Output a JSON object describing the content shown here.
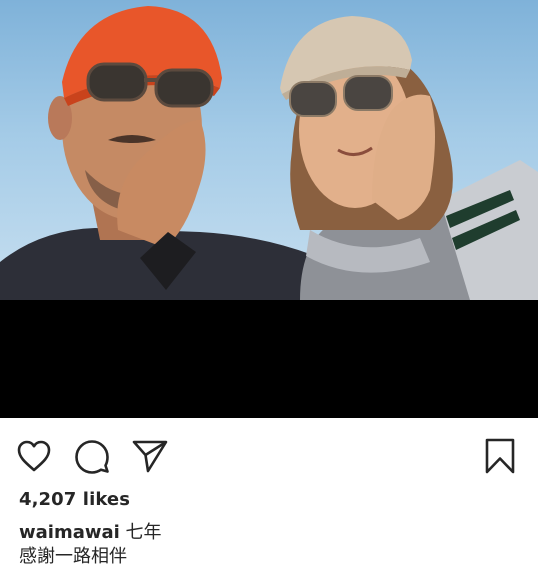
{
  "post": {
    "photo_alt": "Selfie of two people wearing sunglasses and caps against a blue sky",
    "likes_count_text": "4,207 likes",
    "caption": {
      "username": "waimawai",
      "text_line1": "七年",
      "text_line2": "感謝一路相伴"
    }
  },
  "actions": {
    "like_icon": "heart-outline",
    "comment_icon": "speech-bubble-outline",
    "share_icon": "paper-plane-outline",
    "save_icon": "bookmark-outline"
  },
  "colors": {
    "text": "#262626",
    "icon_stroke": "#262626",
    "black_band": "#000000",
    "sky_top": "#7fb2d9",
    "sky_bottom": "#c7dff0",
    "cap_orange": "#e8562a",
    "cap_beige": "#d6c7b2"
  }
}
